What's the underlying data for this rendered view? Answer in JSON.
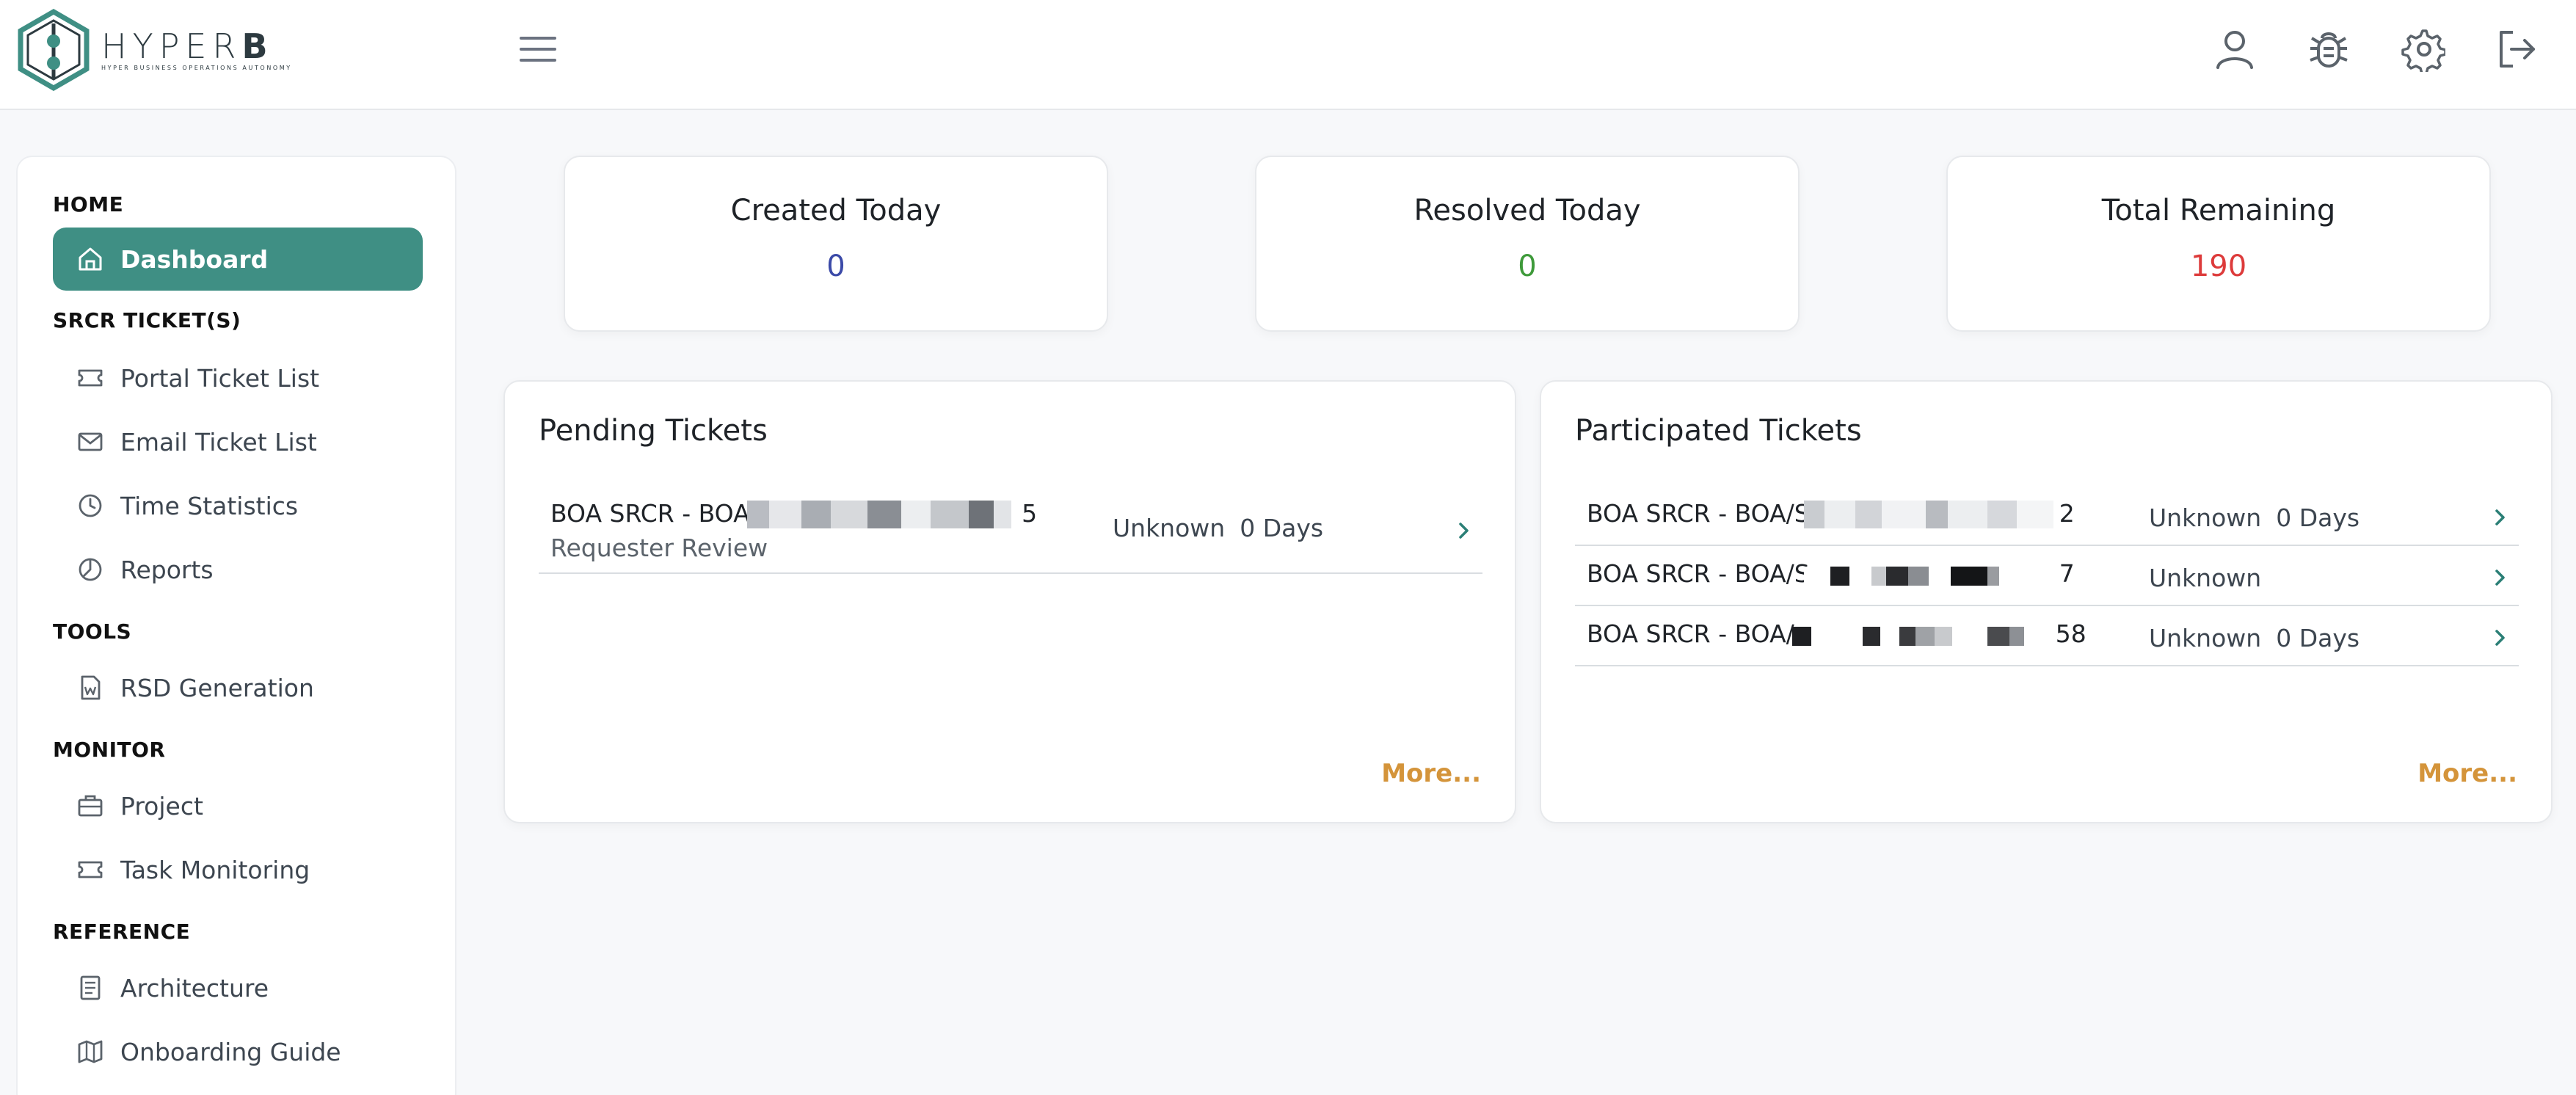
{
  "brand": {
    "name_light": "HYPER",
    "name_bold": "B",
    "tagline": "HYPER BUSINESS OPERATIONS AUTONOMY"
  },
  "topbar": {
    "icons": [
      "menu-icon",
      "user-icon",
      "bug-icon",
      "gear-icon",
      "logout-icon"
    ]
  },
  "sidebar": {
    "sections": {
      "home": "HOME",
      "tickets": "SRCR TICKET(S)",
      "tools": "TOOLS",
      "monitor": "MONITOR",
      "reference": "REFERENCE"
    },
    "items": {
      "dashboard": {
        "label": "Dashboard",
        "icon": "home-icon"
      },
      "portal": {
        "label": "Portal Ticket List",
        "icon": "ticket-icon"
      },
      "email": {
        "label": "Email Ticket List",
        "icon": "mail-icon"
      },
      "time": {
        "label": "Time Statistics",
        "icon": "clock-icon"
      },
      "reports": {
        "label": "Reports",
        "icon": "pie-chart-icon"
      },
      "rsd": {
        "label": "RSD Generation",
        "icon": "word-document-icon"
      },
      "project": {
        "label": "Project",
        "icon": "briefcase-icon"
      },
      "task": {
        "label": "Task Monitoring",
        "icon": "ticket-icon"
      },
      "architecture": {
        "label": "Architecture",
        "icon": "document-icon"
      },
      "onboarding": {
        "label": "Onboarding Guide",
        "icon": "map-icon"
      }
    }
  },
  "stats": {
    "created": {
      "title": "Created Today",
      "value": "0",
      "color": "#3b4aa8"
    },
    "resolved": {
      "title": "Resolved Today",
      "value": "0",
      "color": "#3e9a3a"
    },
    "remaining": {
      "title": "Total Remaining",
      "value": "190",
      "color": "#dd3b3b"
    }
  },
  "pending": {
    "title": "Pending Tickets",
    "rows": [
      {
        "name": "BOA SRCR - BOA,",
        "suffix": "5",
        "sub": "Requester Review",
        "status": "Unknown",
        "days": "0 Days"
      }
    ],
    "more": "More..."
  },
  "participated": {
    "title": "Participated Tickets",
    "rows": [
      {
        "name": "BOA SRCR - BOA/S",
        "suffix": "2",
        "status": "Unknown",
        "days": "0 Days"
      },
      {
        "name": "BOA SRCR - BOA/S",
        "suffix": "7",
        "status": "Unknown",
        "days": ""
      },
      {
        "name": "BOA SRCR - BOA/",
        "suffix": "58",
        "status": "Unknown",
        "days": "0 Days"
      }
    ],
    "more": "More..."
  },
  "colors": {
    "accent": "#3f8f84",
    "more": "#d4943a",
    "chevron": "#2b7f76"
  }
}
